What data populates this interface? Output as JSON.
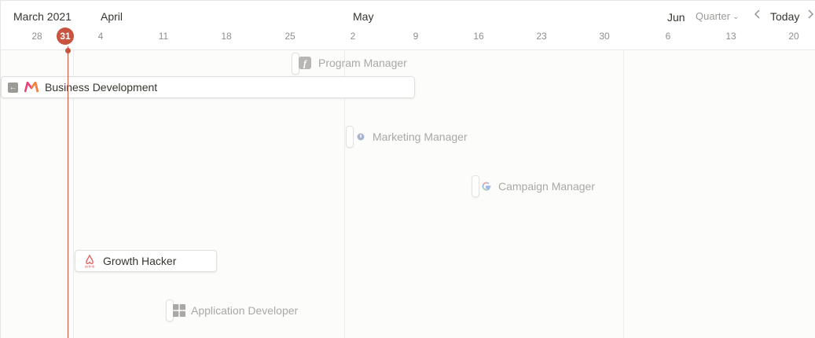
{
  "timeline": {
    "months": [
      "March 2021",
      "April",
      "May",
      "Jun"
    ],
    "days": [
      "28",
      "4",
      "11",
      "18",
      "25",
      "2",
      "9",
      "16",
      "23",
      "30",
      "6",
      "13",
      "20"
    ],
    "today_day": "31"
  },
  "controls": {
    "view_label": "Quarter",
    "today_label": "Today"
  },
  "colors": {
    "accent_today": "#c8543f",
    "grid_line": "#ececea"
  },
  "items": [
    {
      "label": "Program Manager",
      "icon": "font-f-icon",
      "style": "faded"
    },
    {
      "label": "Business Development",
      "icon": "myntra-logo-icon",
      "style": "card"
    },
    {
      "label": "Marketing Manager",
      "icon": "info-dot-icon",
      "style": "faded"
    },
    {
      "label": "Campaign Manager",
      "icon": "google-g-icon",
      "style": "faded"
    },
    {
      "label": "Growth Hacker",
      "icon": "airbnb-logo-icon",
      "style": "card"
    },
    {
      "label": "Application Developer",
      "icon": "windows-grid-icon",
      "style": "faded"
    }
  ]
}
